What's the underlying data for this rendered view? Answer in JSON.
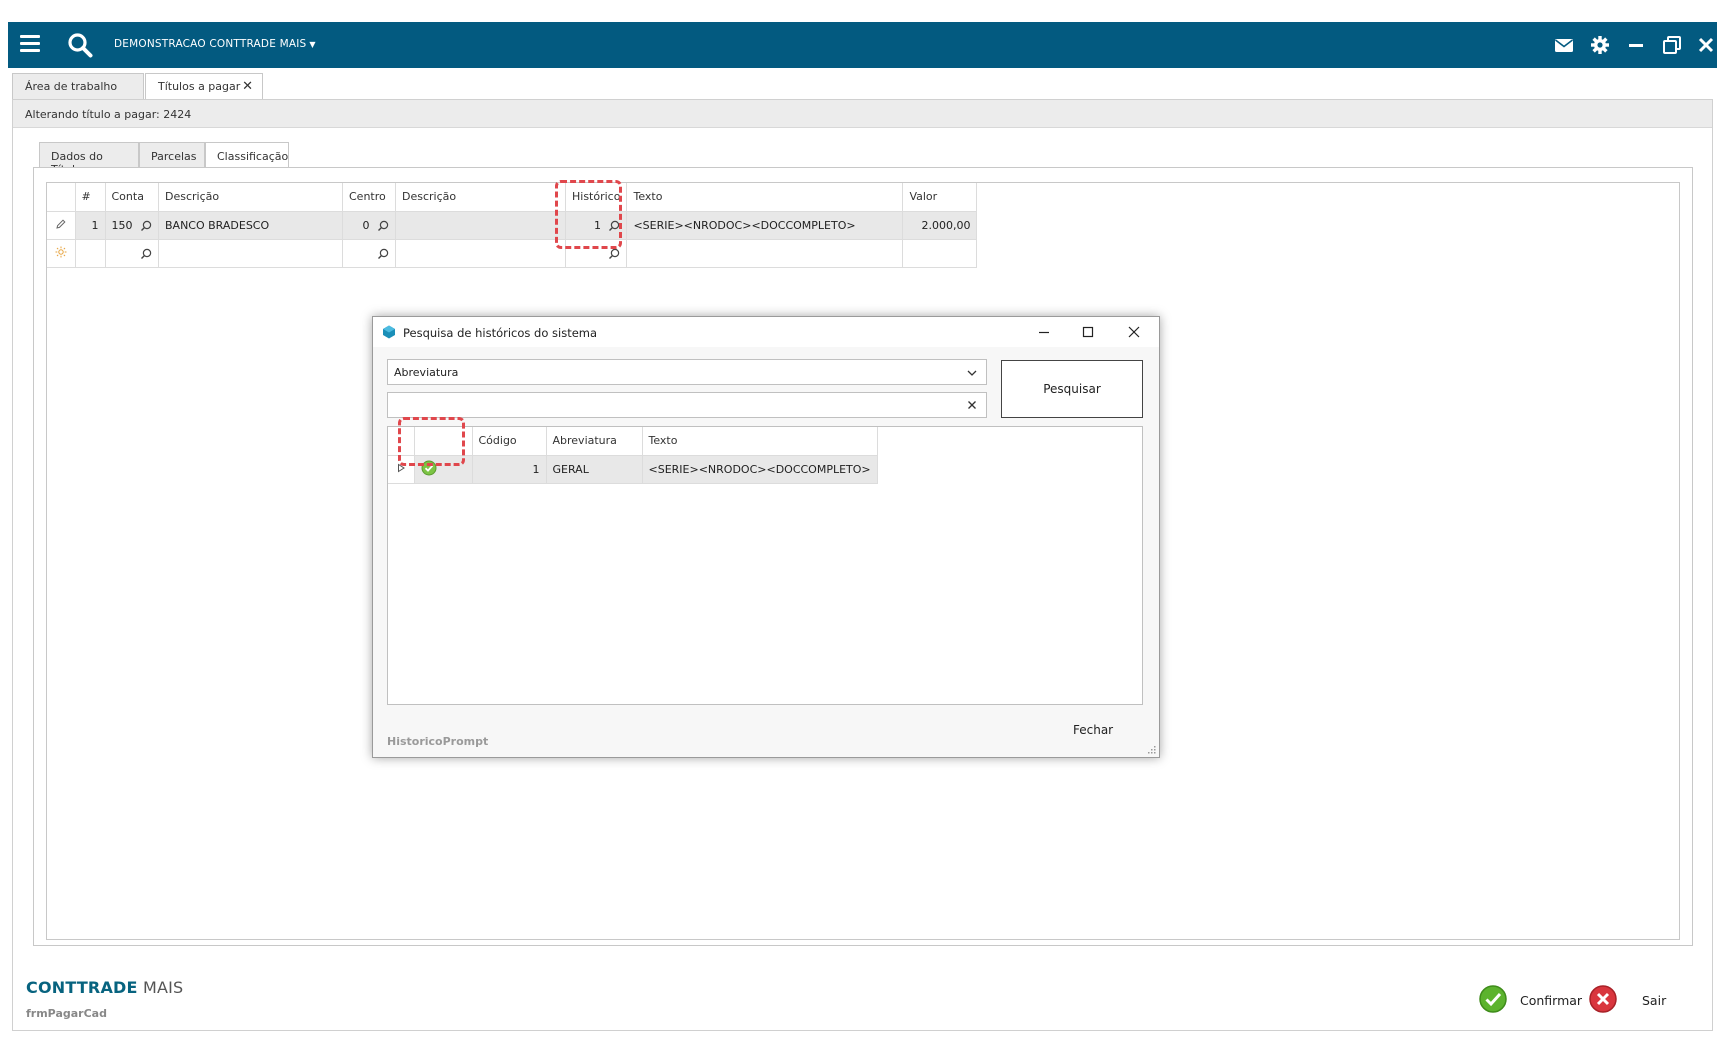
{
  "topbar": {
    "company": "DEMONSTRACAO CONTTRADE MAIS",
    "icons": [
      "menu-icon",
      "search-icon",
      "mail-icon",
      "gear-icon",
      "minimize-icon",
      "restore-icon",
      "close-icon"
    ]
  },
  "tabs": [
    {
      "label": "Área de trabalho",
      "active": false
    },
    {
      "label": "Títulos a pagar",
      "active": true,
      "closable": true
    }
  ],
  "frame": {
    "header": "Alterando título a pagar: 2424"
  },
  "inner_tabs": [
    {
      "label": "Dados do Título",
      "active": false
    },
    {
      "label": "Parcelas",
      "active": false
    },
    {
      "label": "Classificação",
      "active": true
    }
  ],
  "grid": {
    "columns": [
      "#",
      "Conta",
      "Descrição",
      "Centro",
      "Descrição",
      "Histórico",
      "Texto",
      "Valor"
    ],
    "rows": [
      {
        "num": "1",
        "conta": "150",
        "descricao": "BANCO BRADESCO",
        "centro": "0",
        "descricao2": "",
        "historico": "1",
        "texto": "<SERIE><NRODOC><DOCCOMPLETO>",
        "valor": "2.000,00"
      }
    ]
  },
  "dialog": {
    "title": "Pesquisa de históricos do sistema",
    "combo_value": "Abreviatura",
    "search_value": "",
    "search_button": "Pesquisar",
    "columns": [
      "Código",
      "Abreviatura",
      "Texto"
    ],
    "rows": [
      {
        "codigo": "1",
        "abreviatura": "GERAL",
        "texto": "<SERIE><NRODOC><DOCCOMPLETO>"
      }
    ],
    "footer_name": "HistoricoPrompt",
    "close_button": "Fechar"
  },
  "footer": {
    "brand_part1": "CONTTRADE",
    "brand_part2": " MAIS",
    "form_name": "frmPagarCad",
    "confirm_label": "Confirmar",
    "exit_label": "Sair"
  },
  "colors": {
    "topbar": "#035a80",
    "highlight": "#e0474c",
    "confirm_green": "#5cb32e",
    "exit_red": "#d9363e"
  }
}
